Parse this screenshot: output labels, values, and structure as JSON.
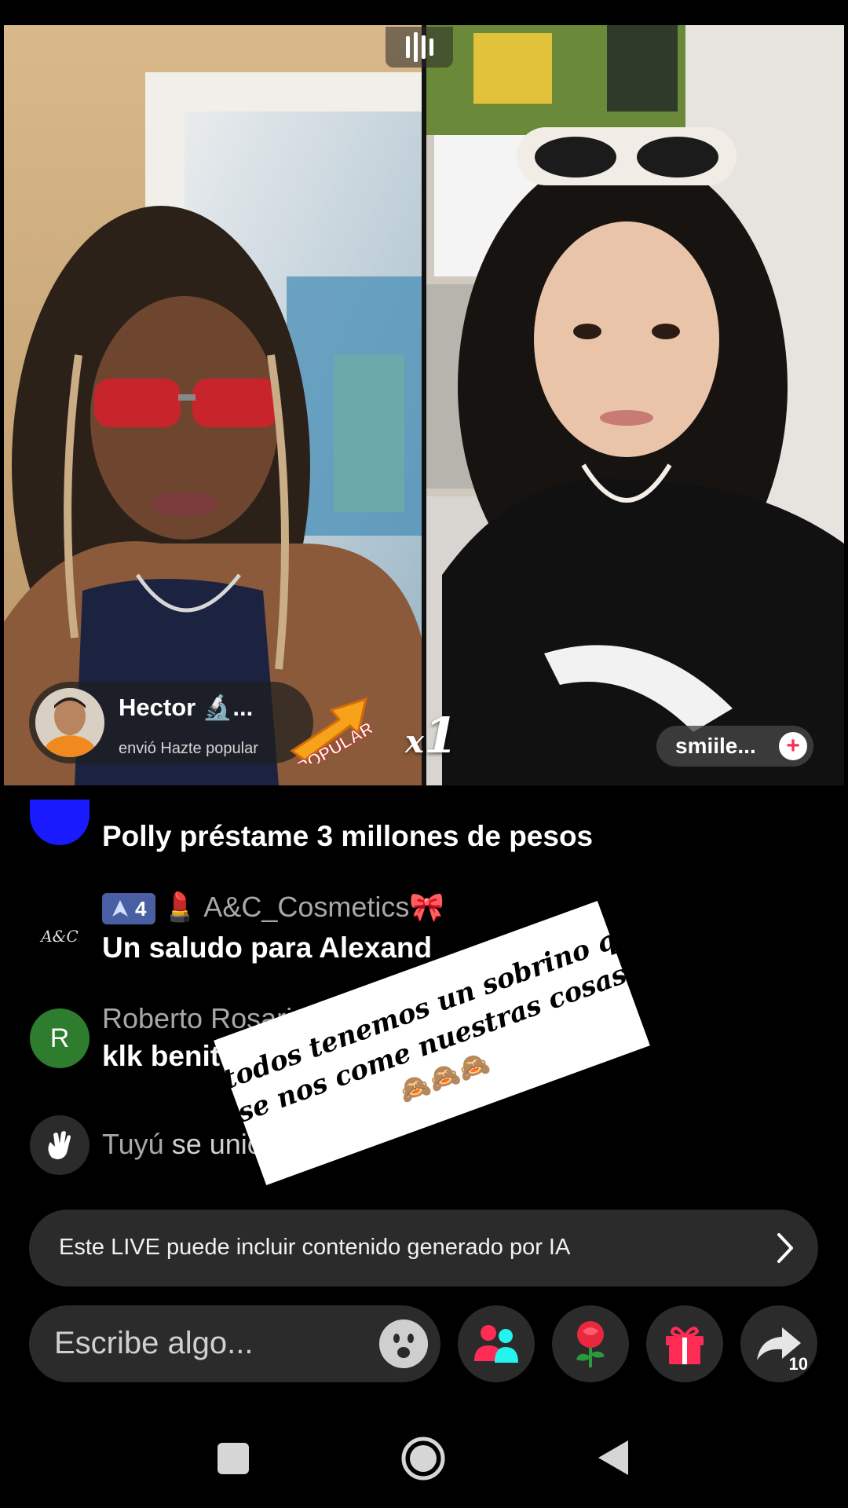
{
  "stream": {
    "guest_name": "smiile...",
    "combo_x": "x",
    "combo_count": "1"
  },
  "gift": {
    "sender": "Hector 🔬...",
    "message": "envió Hazte popular",
    "badge_text": "POPULAR"
  },
  "chat": [
    {
      "user": "",
      "message": "Polly préstame 3 millones de pesos",
      "avatar_color": "#1a1aff"
    },
    {
      "level": "4",
      "user": "💄 A&C_Cosmetics🎀",
      "message": "Un saludo para Alexand",
      "avatar_text": "A&C"
    },
    {
      "user": "Roberto Rosari",
      "message": "klk benit",
      "avatar_letter": "R",
      "avatar_color": "#2e7d2e"
    }
  ],
  "join": {
    "user": "Tuyú",
    "action": "se unió"
  },
  "sticker": {
    "line1": "todos tenemos un sobrino q",
    "line2": "se nos come nuestras cosas",
    "line3": "🙈🙈🙈"
  },
  "ai_notice": "Este LIVE puede incluir contenido generado por IA",
  "comment": {
    "placeholder": "Escribe algo..."
  },
  "share_count": "10",
  "colors": {
    "accent": "#fe2c55",
    "teal": "#25f4ee",
    "level_badge": "#4a5fa3"
  },
  "icons": [
    "bars-icon",
    "add-icon",
    "emoji-icon",
    "guests-icon",
    "rose-icon",
    "gift-icon",
    "share-icon",
    "chevron-right-icon",
    "nav-home-icon",
    "nav-recent-icon",
    "nav-back-icon"
  ]
}
